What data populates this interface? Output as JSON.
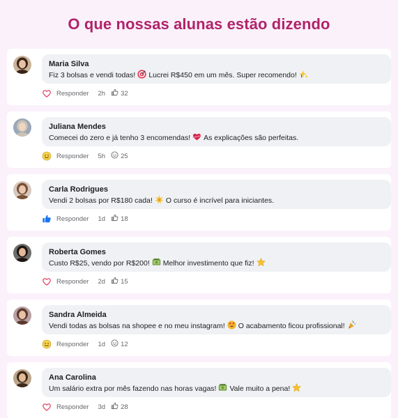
{
  "page": {
    "title": "O que nossas alunas estão dizendo"
  },
  "colors": {
    "title": "#b0236a",
    "background": "#fbf1fb",
    "bubble": "#eff1f4",
    "meta": "#65676b"
  },
  "comments": [
    {
      "name": "Maria Silva",
      "text_before": "Fiz 3 bolsas e vendi todas!",
      "emoji1": "target-emoji",
      "text_middle": "Lucrei R$450 em um mês. Super recomendo!",
      "emoji2": "sparkles-emoji",
      "text_after": "",
      "reaction_icon": "heart-outline-icon",
      "reply_label": "Responder",
      "time": "2h",
      "likes": "32"
    },
    {
      "name": "Juliana Mendes",
      "text_before": "Comecei do zero e já tenho 3 encomendas!",
      "emoji1": "heart-emoji",
      "text_middle": "As explicações são perfeitas.",
      "emoji2": "",
      "text_after": "",
      "reaction_icon": "smile-icon",
      "reply_label": "Responder",
      "time": "5h",
      "likes": "25"
    },
    {
      "name": "Carla Rodrigues",
      "text_before": "Vendi 2 bolsas por R$180 cada!",
      "emoji1": "star-burst-emoji",
      "text_middle": "O curso é incrível para iniciantes.",
      "emoji2": "",
      "text_after": "",
      "reaction_icon": "thumbs-up-icon",
      "reply_label": "Responder",
      "time": "1d",
      "likes": "18"
    },
    {
      "name": "Roberta Gomes",
      "text_before": "Custo R$25, vendo por R$200!",
      "emoji1": "money-emoji",
      "text_middle": "Melhor investimento que fiz!",
      "emoji2": "star-emoji",
      "text_after": "",
      "reaction_icon": "heart-outline-icon",
      "reply_label": "Responder",
      "time": "2d",
      "likes": "15"
    },
    {
      "name": "Sandra Almeida",
      "text_before": "Vendi todas as bolsas na shopee e no meu instagram!",
      "emoji1": "heart-eyes-emoji",
      "text_middle": "O acabamento ficou profissional!",
      "emoji2": "party-emoji",
      "text_after": "",
      "reaction_icon": "smile-icon",
      "reply_label": "Responder",
      "time": "1d",
      "likes": "12"
    },
    {
      "name": "Ana Carolina",
      "text_before": "Um salário extra por mês fazendo nas horas vagas!",
      "emoji1": "money-emoji",
      "text_middle": "Vale muito a pena!",
      "emoji2": "star-emoji",
      "text_after": "",
      "reaction_icon": "heart-outline-icon",
      "reply_label": "Responder",
      "time": "3d",
      "likes": "28"
    }
  ]
}
